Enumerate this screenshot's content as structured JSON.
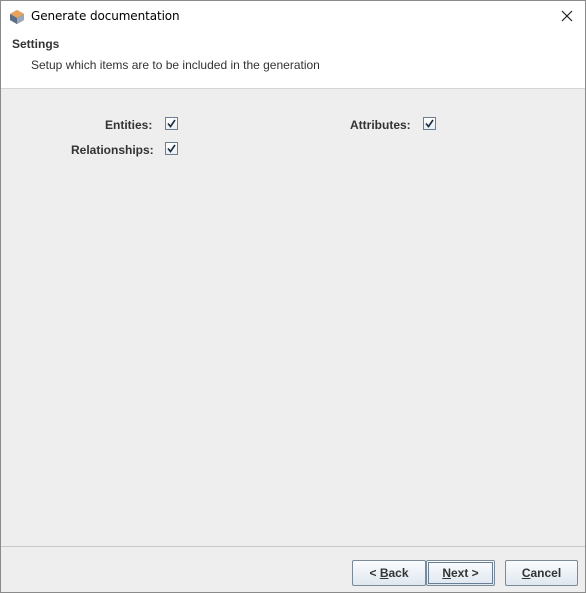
{
  "window": {
    "title": "Generate documentation",
    "icon": "app-logo-icon",
    "close_icon": "close-icon"
  },
  "header": {
    "title": "Settings",
    "subtitle": "Setup which items are to be included in the generation"
  },
  "options": {
    "entities": {
      "label": "Entities:",
      "checked": true
    },
    "attributes": {
      "label": "Attributes:",
      "checked": true
    },
    "relationships": {
      "label": "Relationships:",
      "checked": true
    }
  },
  "buttons": {
    "back": {
      "mnemonic": "< ",
      "mnemonic_char": "B",
      "rest": "ack"
    },
    "next": {
      "mnemonic_char": "N",
      "rest": "ext >"
    },
    "cancel": {
      "mnemonic_char": "C",
      "rest": "ancel"
    }
  },
  "colors": {
    "header_bg": "#ffffff",
    "content_bg": "#eeeeee",
    "button_border": "#7a8a99"
  }
}
